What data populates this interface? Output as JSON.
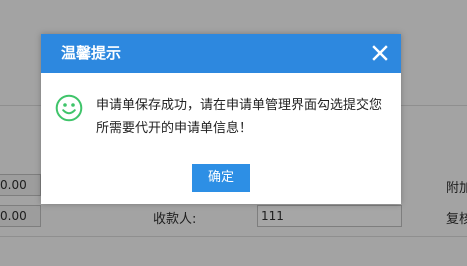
{
  "background_form": {
    "row1": {
      "left_value": "0.00",
      "right_label": "附加"
    },
    "row2": {
      "left_value": "0.00",
      "payee_label": "收款人:",
      "payee_value": "111",
      "right_label": "复核"
    }
  },
  "dialog": {
    "title": "温馨提示",
    "close_icon": "close-icon",
    "status_icon": "smile-icon",
    "message": "申请单保存成功，请在申请单管理界面勾选提交您所需要代开的申请单信息！",
    "ok_label": "确定"
  },
  "colors": {
    "header": "#2d88df",
    "button": "#2d8fe5",
    "icon": "#3fc46a",
    "overlay": "#a3a3a3"
  }
}
